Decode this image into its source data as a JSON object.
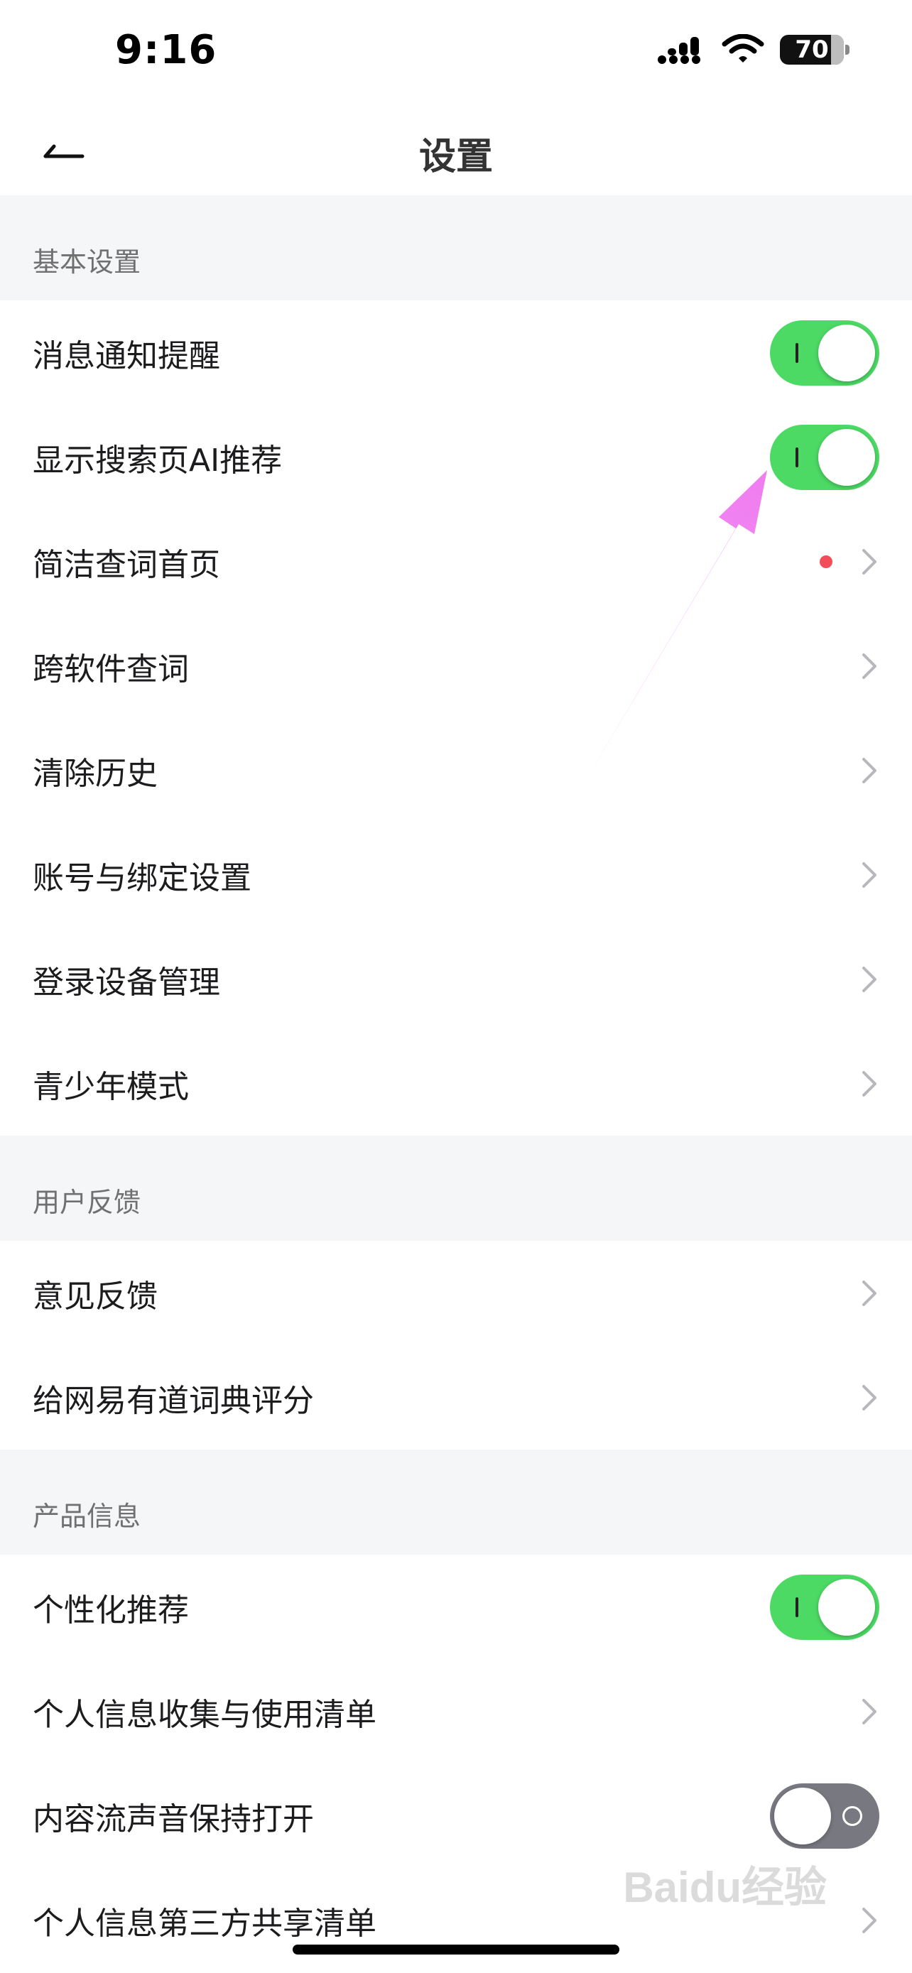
{
  "status_bar": {
    "time": "9:16",
    "battery": "70"
  },
  "nav": {
    "title": "设置"
  },
  "sections": [
    {
      "header": "基本设置",
      "rows": [
        {
          "label": "消息通知提醒",
          "type": "toggle",
          "on": true
        },
        {
          "label": "显示搜索页AI推荐",
          "type": "toggle",
          "on": true
        },
        {
          "label": "简洁查词首页",
          "type": "link",
          "badge": true
        },
        {
          "label": "跨软件查词",
          "type": "link"
        },
        {
          "label": "清除历史",
          "type": "link"
        },
        {
          "label": "账号与绑定设置",
          "type": "link"
        },
        {
          "label": "登录设备管理",
          "type": "link"
        },
        {
          "label": "青少年模式",
          "type": "link"
        }
      ]
    },
    {
      "header": "用户反馈",
      "rows": [
        {
          "label": "意见反馈",
          "type": "link"
        },
        {
          "label": "给网易有道词典评分",
          "type": "link"
        }
      ]
    },
    {
      "header": "产品信息",
      "rows": [
        {
          "label": "个性化推荐",
          "type": "toggle",
          "on": true
        },
        {
          "label": "个人信息收集与使用清单",
          "type": "link"
        },
        {
          "label": "内容流声音保持打开",
          "type": "toggle",
          "on": false
        },
        {
          "label": "个人信息第三方共享清单",
          "type": "link"
        }
      ]
    }
  ],
  "watermark": "Baidu经验",
  "colors": {
    "toggle_on": "#4cd964",
    "toggle_off": "#787880",
    "badge": "#f24e5a",
    "annotation_arrow": "#f07cf0"
  }
}
